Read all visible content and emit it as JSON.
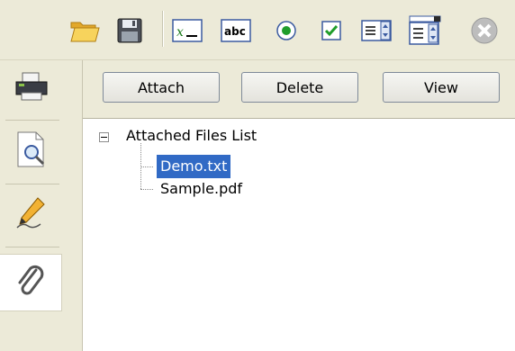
{
  "toolbar": {
    "icons": [
      "open-folder-icon",
      "save-disk-icon",
      "text-field-icon",
      "abc-field-icon",
      "radio-button-icon",
      "checkbox-icon",
      "list-box-icon",
      "combo-box-icon",
      "close-disabled-icon"
    ],
    "colors": {
      "background": "#ecead8",
      "folder": "#f2c94c",
      "disk": "#4a4a4a",
      "check": "#1f9d2a",
      "radio": "#1f9d2a"
    }
  },
  "sidebar": {
    "items": [
      {
        "icon": "printer-icon",
        "active": false
      },
      {
        "icon": "print-preview-icon",
        "active": false
      },
      {
        "icon": "signature-pen-icon",
        "active": false
      },
      {
        "icon": "paperclip-icon",
        "active": true
      }
    ]
  },
  "attachments": {
    "buttons": {
      "attach": "Attach",
      "delete": "Delete",
      "view": "View"
    },
    "tree": {
      "root": "Attached Files List",
      "expanded": true,
      "children": [
        "Demo.txt",
        "Sample.pdf"
      ],
      "selected_index": 0
    },
    "colors": {
      "selection": "#316ac5"
    }
  }
}
